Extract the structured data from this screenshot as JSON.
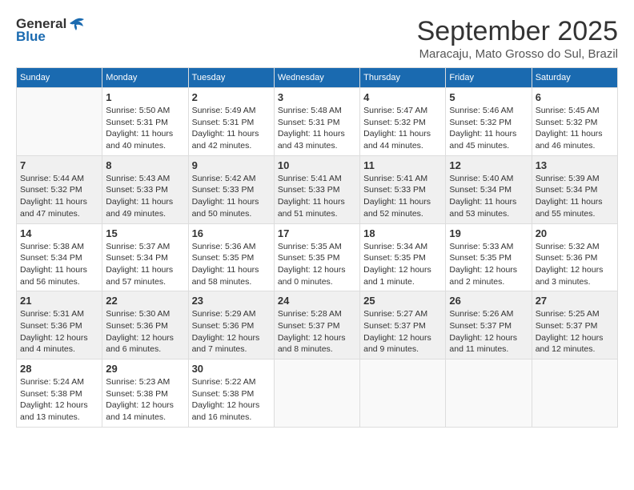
{
  "logo": {
    "line1": "General",
    "line2": "Blue"
  },
  "title": "September 2025",
  "subtitle": "Maracaju, Mato Grosso do Sul, Brazil",
  "days_of_week": [
    "Sunday",
    "Monday",
    "Tuesday",
    "Wednesday",
    "Thursday",
    "Friday",
    "Saturday"
  ],
  "weeks": [
    [
      {
        "day": "",
        "sunrise": "",
        "sunset": "",
        "daylight": ""
      },
      {
        "day": "1",
        "sunrise": "Sunrise: 5:50 AM",
        "sunset": "Sunset: 5:31 PM",
        "daylight": "Daylight: 11 hours and 40 minutes."
      },
      {
        "day": "2",
        "sunrise": "Sunrise: 5:49 AM",
        "sunset": "Sunset: 5:31 PM",
        "daylight": "Daylight: 11 hours and 42 minutes."
      },
      {
        "day": "3",
        "sunrise": "Sunrise: 5:48 AM",
        "sunset": "Sunset: 5:31 PM",
        "daylight": "Daylight: 11 hours and 43 minutes."
      },
      {
        "day": "4",
        "sunrise": "Sunrise: 5:47 AM",
        "sunset": "Sunset: 5:32 PM",
        "daylight": "Daylight: 11 hours and 44 minutes."
      },
      {
        "day": "5",
        "sunrise": "Sunrise: 5:46 AM",
        "sunset": "Sunset: 5:32 PM",
        "daylight": "Daylight: 11 hours and 45 minutes."
      },
      {
        "day": "6",
        "sunrise": "Sunrise: 5:45 AM",
        "sunset": "Sunset: 5:32 PM",
        "daylight": "Daylight: 11 hours and 46 minutes."
      }
    ],
    [
      {
        "day": "7",
        "sunrise": "Sunrise: 5:44 AM",
        "sunset": "Sunset: 5:32 PM",
        "daylight": "Daylight: 11 hours and 47 minutes."
      },
      {
        "day": "8",
        "sunrise": "Sunrise: 5:43 AM",
        "sunset": "Sunset: 5:33 PM",
        "daylight": "Daylight: 11 hours and 49 minutes."
      },
      {
        "day": "9",
        "sunrise": "Sunrise: 5:42 AM",
        "sunset": "Sunset: 5:33 PM",
        "daylight": "Daylight: 11 hours and 50 minutes."
      },
      {
        "day": "10",
        "sunrise": "Sunrise: 5:41 AM",
        "sunset": "Sunset: 5:33 PM",
        "daylight": "Daylight: 11 hours and 51 minutes."
      },
      {
        "day": "11",
        "sunrise": "Sunrise: 5:41 AM",
        "sunset": "Sunset: 5:33 PM",
        "daylight": "Daylight: 11 hours and 52 minutes."
      },
      {
        "day": "12",
        "sunrise": "Sunrise: 5:40 AM",
        "sunset": "Sunset: 5:34 PM",
        "daylight": "Daylight: 11 hours and 53 minutes."
      },
      {
        "day": "13",
        "sunrise": "Sunrise: 5:39 AM",
        "sunset": "Sunset: 5:34 PM",
        "daylight": "Daylight: 11 hours and 55 minutes."
      }
    ],
    [
      {
        "day": "14",
        "sunrise": "Sunrise: 5:38 AM",
        "sunset": "Sunset: 5:34 PM",
        "daylight": "Daylight: 11 hours and 56 minutes."
      },
      {
        "day": "15",
        "sunrise": "Sunrise: 5:37 AM",
        "sunset": "Sunset: 5:34 PM",
        "daylight": "Daylight: 11 hours and 57 minutes."
      },
      {
        "day": "16",
        "sunrise": "Sunrise: 5:36 AM",
        "sunset": "Sunset: 5:35 PM",
        "daylight": "Daylight: 11 hours and 58 minutes."
      },
      {
        "day": "17",
        "sunrise": "Sunrise: 5:35 AM",
        "sunset": "Sunset: 5:35 PM",
        "daylight": "Daylight: 12 hours and 0 minutes."
      },
      {
        "day": "18",
        "sunrise": "Sunrise: 5:34 AM",
        "sunset": "Sunset: 5:35 PM",
        "daylight": "Daylight: 12 hours and 1 minute."
      },
      {
        "day": "19",
        "sunrise": "Sunrise: 5:33 AM",
        "sunset": "Sunset: 5:35 PM",
        "daylight": "Daylight: 12 hours and 2 minutes."
      },
      {
        "day": "20",
        "sunrise": "Sunrise: 5:32 AM",
        "sunset": "Sunset: 5:36 PM",
        "daylight": "Daylight: 12 hours and 3 minutes."
      }
    ],
    [
      {
        "day": "21",
        "sunrise": "Sunrise: 5:31 AM",
        "sunset": "Sunset: 5:36 PM",
        "daylight": "Daylight: 12 hours and 4 minutes."
      },
      {
        "day": "22",
        "sunrise": "Sunrise: 5:30 AM",
        "sunset": "Sunset: 5:36 PM",
        "daylight": "Daylight: 12 hours and 6 minutes."
      },
      {
        "day": "23",
        "sunrise": "Sunrise: 5:29 AM",
        "sunset": "Sunset: 5:36 PM",
        "daylight": "Daylight: 12 hours and 7 minutes."
      },
      {
        "day": "24",
        "sunrise": "Sunrise: 5:28 AM",
        "sunset": "Sunset: 5:37 PM",
        "daylight": "Daylight: 12 hours and 8 minutes."
      },
      {
        "day": "25",
        "sunrise": "Sunrise: 5:27 AM",
        "sunset": "Sunset: 5:37 PM",
        "daylight": "Daylight: 12 hours and 9 minutes."
      },
      {
        "day": "26",
        "sunrise": "Sunrise: 5:26 AM",
        "sunset": "Sunset: 5:37 PM",
        "daylight": "Daylight: 12 hours and 11 minutes."
      },
      {
        "day": "27",
        "sunrise": "Sunrise: 5:25 AM",
        "sunset": "Sunset: 5:37 PM",
        "daylight": "Daylight: 12 hours and 12 minutes."
      }
    ],
    [
      {
        "day": "28",
        "sunrise": "Sunrise: 5:24 AM",
        "sunset": "Sunset: 5:38 PM",
        "daylight": "Daylight: 12 hours and 13 minutes."
      },
      {
        "day": "29",
        "sunrise": "Sunrise: 5:23 AM",
        "sunset": "Sunset: 5:38 PM",
        "daylight": "Daylight: 12 hours and 14 minutes."
      },
      {
        "day": "30",
        "sunrise": "Sunrise: 5:22 AM",
        "sunset": "Sunset: 5:38 PM",
        "daylight": "Daylight: 12 hours and 16 minutes."
      },
      {
        "day": "",
        "sunrise": "",
        "sunset": "",
        "daylight": ""
      },
      {
        "day": "",
        "sunrise": "",
        "sunset": "",
        "daylight": ""
      },
      {
        "day": "",
        "sunrise": "",
        "sunset": "",
        "daylight": ""
      },
      {
        "day": "",
        "sunrise": "",
        "sunset": "",
        "daylight": ""
      }
    ]
  ]
}
